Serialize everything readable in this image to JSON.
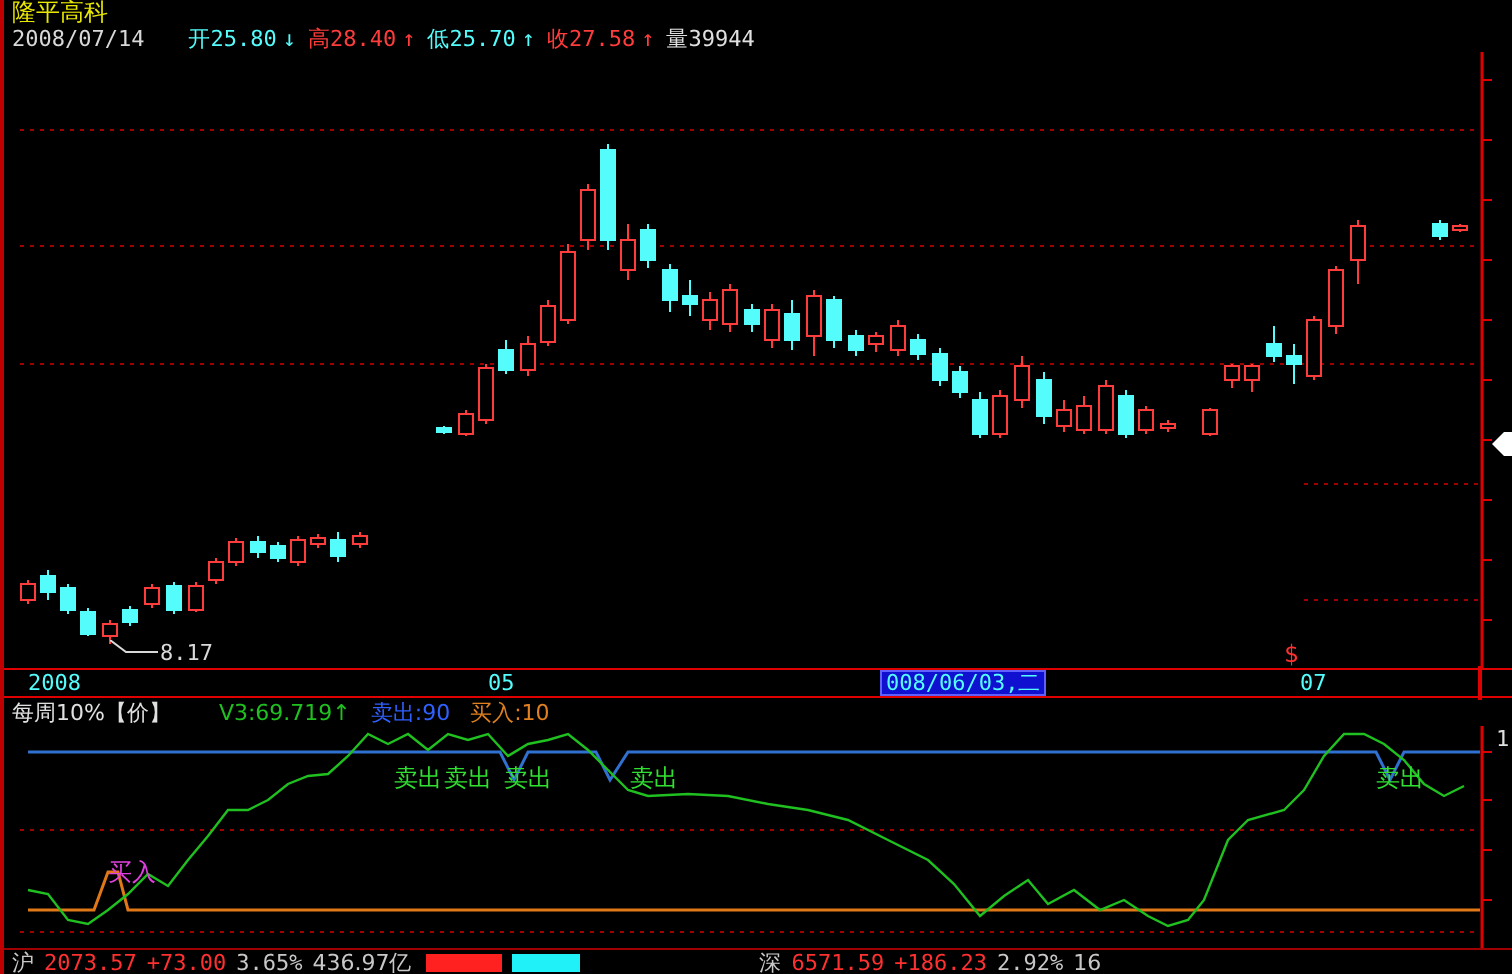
{
  "stock": {
    "name": "隆平高科"
  },
  "quote": {
    "date": "2008/07/14",
    "items": [
      {
        "text": "开25.80",
        "arrow": "↓",
        "color": "#54fcfc"
      },
      {
        "text": "高28.40",
        "arrow": "↑",
        "color": "#ff3c3c"
      },
      {
        "text": "低25.70",
        "arrow": "↑",
        "color": "#54fcfc"
      },
      {
        "text": "收27.58",
        "arrow": "↑",
        "color": "#ff3c3c"
      },
      {
        "text": "量39944",
        "color": "#e0e0e0"
      }
    ]
  },
  "main_chart": {
    "low_label": "8.17",
    "marker": "$"
  },
  "time_axis": {
    "labels": [
      "2008",
      "05",
      "07"
    ],
    "cursor_date": "008/06/03,二"
  },
  "indicator": {
    "name": "每周10%【价】",
    "values": [
      {
        "text": "V3:69.719↑",
        "color": "#20c020"
      },
      {
        "text": "卖出:90",
        "color": "#3060ff"
      },
      {
        "text": "买入:10",
        "color": "#e08020"
      }
    ],
    "axis_value": "1",
    "signals": [
      {
        "text": "卖出",
        "kind": "sell"
      },
      {
        "text": "卖出",
        "kind": "sell"
      },
      {
        "text": "卖出",
        "kind": "sell"
      },
      {
        "text": "卖出",
        "kind": "sell"
      },
      {
        "text": "卖出",
        "kind": "sell"
      },
      {
        "text": "买入",
        "kind": "buy"
      }
    ]
  },
  "status_bar": {
    "markets": [
      {
        "label": "沪",
        "value": "2073.57",
        "change": "+73.00",
        "percent": "3.65%",
        "amount": "436.97亿"
      },
      {
        "label": "深",
        "value": "6571.59",
        "change": "+186.23",
        "percent": "2.92%",
        "amount": "16"
      }
    ]
  }
}
